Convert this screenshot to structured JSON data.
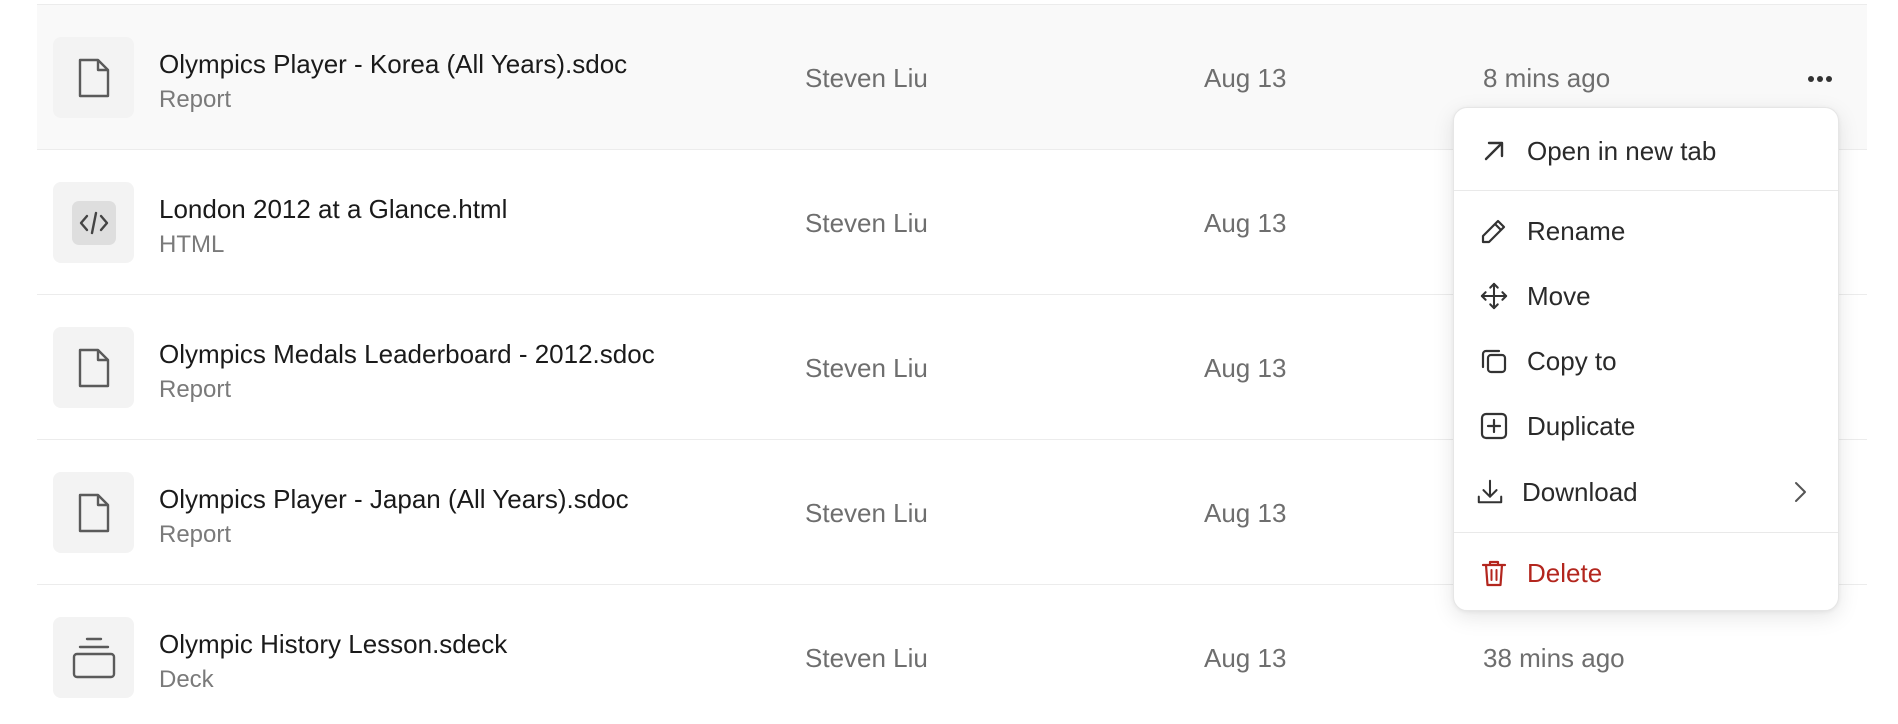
{
  "files": [
    {
      "name": "Olympics Player - Korea (All Years).sdoc",
      "type": "Report",
      "icon": "document-icon",
      "owner": "Steven Liu",
      "created": "Aug 13",
      "modified": "8 mins ago"
    },
    {
      "name": "London 2012 at a Glance.html",
      "type": "HTML",
      "icon": "code-icon",
      "owner": "Steven Liu",
      "created": "Aug 13",
      "modified": ""
    },
    {
      "name": "Olympics Medals Leaderboard - 2012.sdoc",
      "type": "Report",
      "icon": "document-icon",
      "owner": "Steven Liu",
      "created": "Aug 13",
      "modified": ""
    },
    {
      "name": "Olympics Player - Japan (All Years).sdoc",
      "type": "Report",
      "icon": "document-icon",
      "owner": "Steven Liu",
      "created": "Aug 13",
      "modified": ""
    },
    {
      "name": "Olympic History Lesson.sdeck",
      "type": "Deck",
      "icon": "deck-icon",
      "owner": "Steven Liu",
      "created": "Aug 13",
      "modified": "38 mins ago"
    }
  ],
  "context_menu": {
    "items": [
      {
        "label": "Open in new tab",
        "icon": "arrow-up-right-icon"
      },
      {
        "label": "Rename",
        "icon": "pencil-icon"
      },
      {
        "label": "Move",
        "icon": "move-arrows-icon"
      },
      {
        "label": "Copy to",
        "icon": "copy-icon"
      },
      {
        "label": "Duplicate",
        "icon": "plus-square-icon"
      },
      {
        "label": "Download",
        "icon": "download-icon"
      },
      {
        "label": "Delete",
        "icon": "trash-icon"
      }
    ]
  },
  "colors": {
    "text_primary": "#1a1a1a",
    "text_secondary": "#6e6e6e",
    "danger": "#b3261e",
    "row_hover": "#f9f9f9",
    "thumb_bg": "#f3f3f3"
  }
}
